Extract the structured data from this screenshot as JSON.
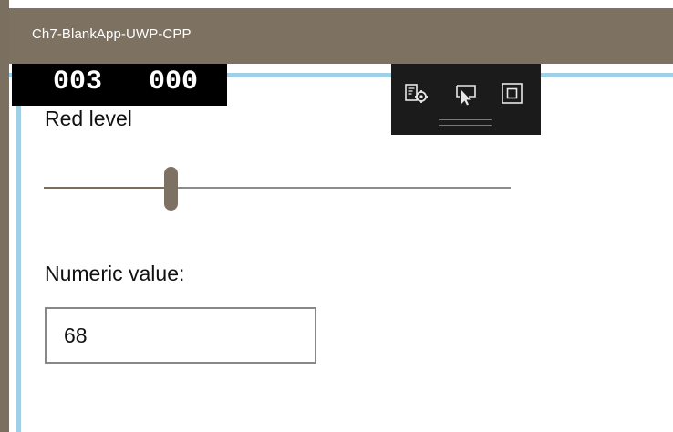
{
  "window": {
    "title": "Ch7-BlankApp-UWP-CPP"
  },
  "frame_counter": {
    "left_value": "003",
    "right_value": "000"
  },
  "debug_toolbar": {
    "tools": [
      "live-visual-tree-icon",
      "select-element-icon",
      "display-layout-adorners-icon"
    ]
  },
  "red_slider": {
    "label": "Red level",
    "value": 68,
    "min": 0,
    "max": 255
  },
  "numeric_field": {
    "label": "Numeric value:",
    "value": "68"
  },
  "colors": {
    "titlebar": "#7d7162",
    "accent_blue": "#9fd0e6",
    "slider_fill": "#7b6e5f"
  }
}
